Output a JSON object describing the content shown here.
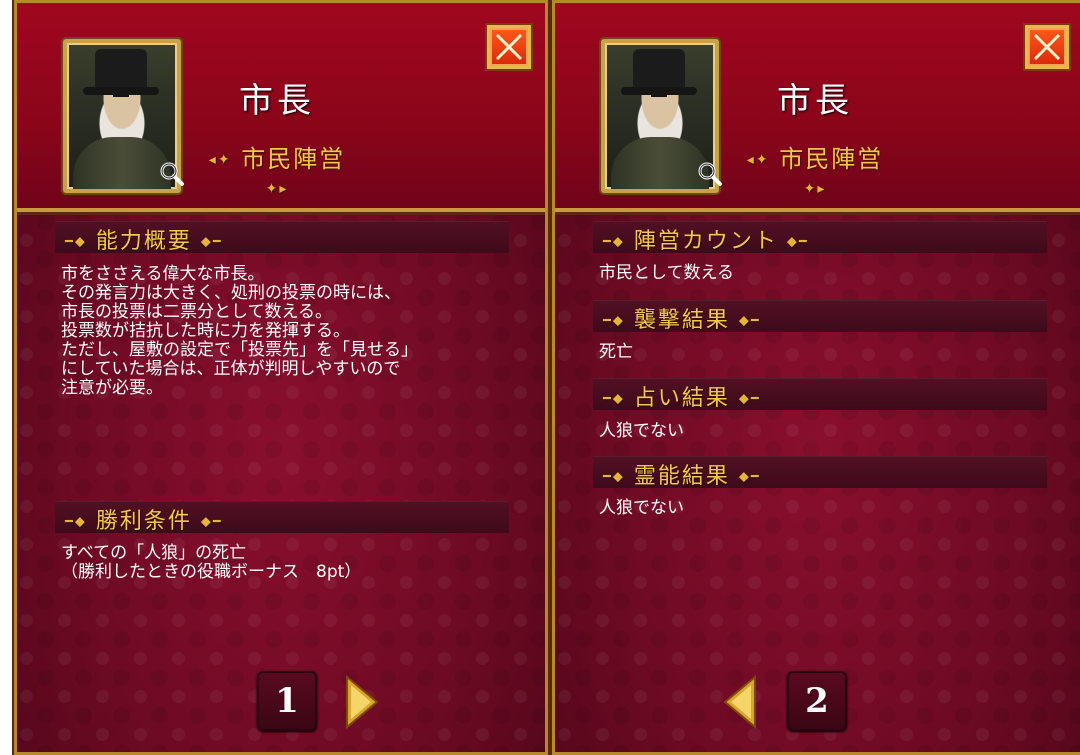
{
  "cards": [
    {
      "title": "市長",
      "faction": "市民陣営",
      "sections": [
        {
          "header": "能力概要",
          "text": "市をささえる偉大な市長。\nその発言力は大きく、処刑の投票の時には、\n市長の投票は二票分として数える。\n投票数が拮抗した時に力を発揮する。\nただし、屋敷の設定で「投票先」を「見せる」\nにしていた場合は、正体が判明しやすいので\n注意が必要。"
        },
        {
          "header": "勝利条件",
          "text": "すべての「人狼」の死亡\n（勝利したときの役職ボーナス　8pt）"
        }
      ],
      "page": "1"
    },
    {
      "title": "市長",
      "faction": "市民陣営",
      "sections": [
        {
          "header": "陣営カウント",
          "text": "市民として数える"
        },
        {
          "header": "襲撃結果",
          "text": "死亡"
        },
        {
          "header": "占い結果",
          "text": "人狼でない"
        },
        {
          "header": "霊能結果",
          "text": "人狼でない"
        }
      ],
      "page": "2"
    }
  ],
  "colors": {
    "accent_gold": "#f4c84b",
    "panel_red": "#8a0519",
    "close_orange": "#ff5a1a"
  },
  "icons": {
    "close": "close-x-icon",
    "magnifier": "magnifier-icon",
    "next": "next-arrow-icon",
    "prev": "prev-arrow-icon"
  }
}
